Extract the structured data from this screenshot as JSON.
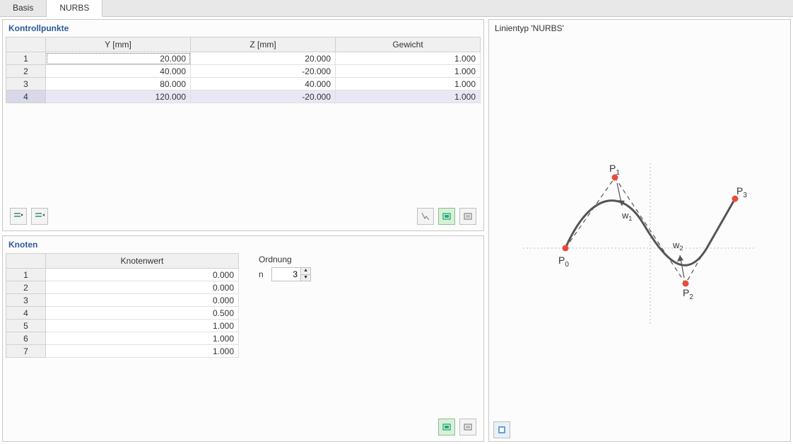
{
  "tabs": [
    {
      "label": "Basis",
      "active": false
    },
    {
      "label": "NURBS",
      "active": true
    }
  ],
  "kontroll": {
    "title": "Kontrollpunkte",
    "headers": {
      "y": "Y [mm]",
      "z": "Z [mm]",
      "w": "Gewicht"
    },
    "rows": [
      {
        "n": "1",
        "y": "20.000",
        "z": "20.000",
        "w": "1.000"
      },
      {
        "n": "2",
        "y": "40.000",
        "z": "-20.000",
        "w": "1.000"
      },
      {
        "n": "3",
        "y": "80.000",
        "z": "40.000",
        "w": "1.000"
      },
      {
        "n": "4",
        "y": "120.000",
        "z": "-20.000",
        "w": "1.000"
      }
    ]
  },
  "knoten": {
    "title": "Knoten",
    "header": "Knotenwert",
    "rows": [
      {
        "n": "1",
        "v": "0.000"
      },
      {
        "n": "2",
        "v": "0.000"
      },
      {
        "n": "3",
        "v": "0.000"
      },
      {
        "n": "4",
        "v": "0.500"
      },
      {
        "n": "5",
        "v": "1.000"
      },
      {
        "n": "6",
        "v": "1.000"
      },
      {
        "n": "7",
        "v": "1.000"
      }
    ],
    "ordnung_label": "Ordnung",
    "n_label": "n",
    "n_value": "3"
  },
  "preview": {
    "title": "Linientyp 'NURBS'",
    "labels": {
      "p0": "P",
      "p1": "P",
      "p2": "P",
      "p3": "P",
      "w1": "w",
      "w2": "w"
    },
    "subs": {
      "p0": "0",
      "p1": "1",
      "p2": "2",
      "p3": "3",
      "w1": "1",
      "w2": "2"
    }
  }
}
